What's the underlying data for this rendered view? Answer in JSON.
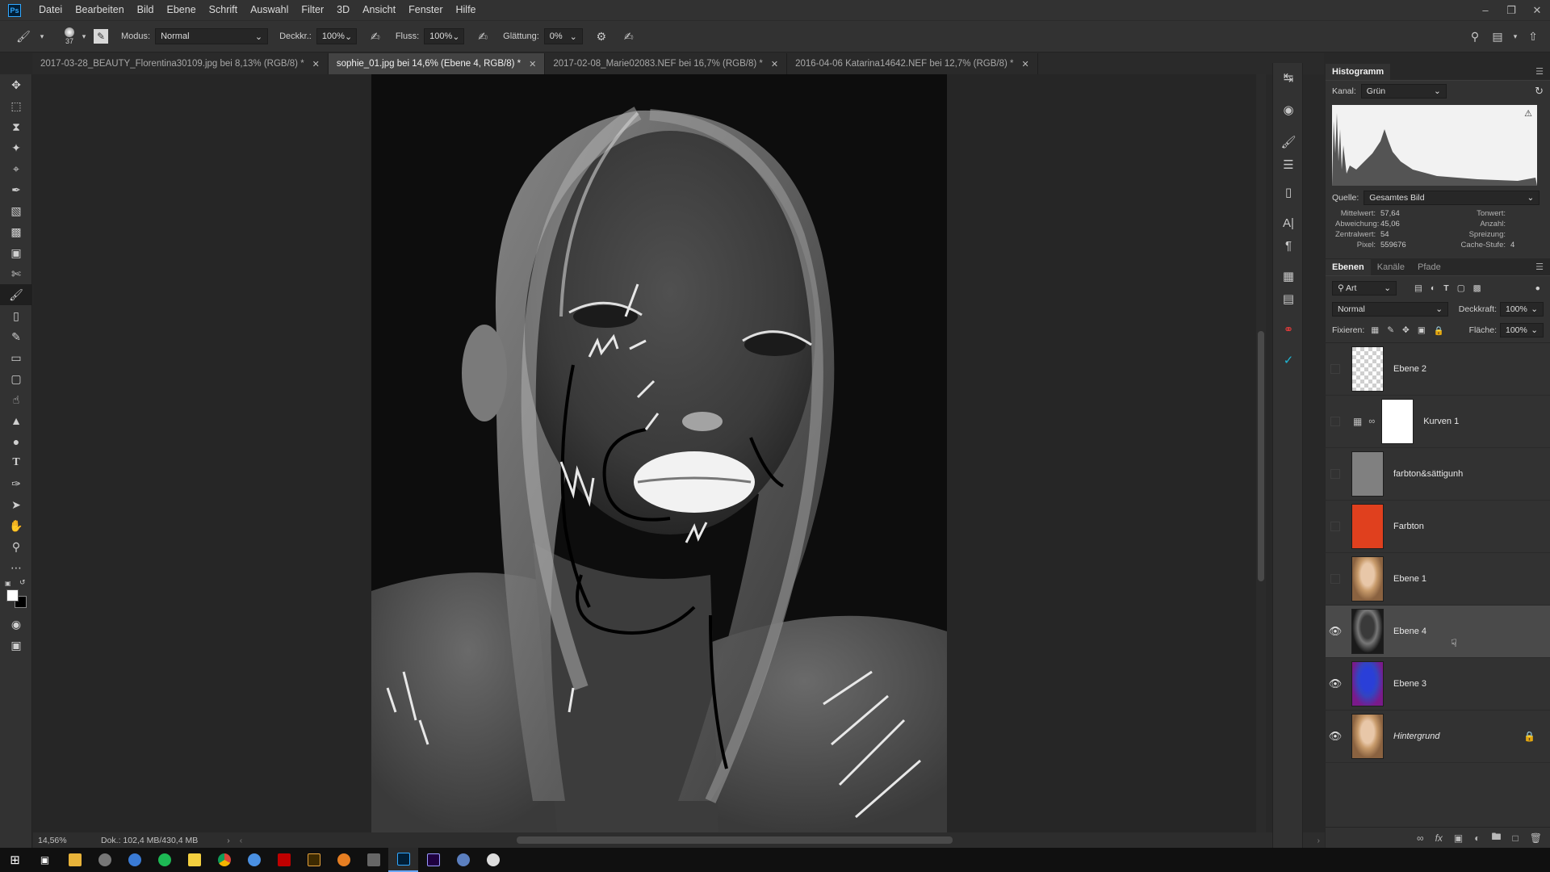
{
  "menubar": {
    "logo": "Ps",
    "items": [
      "Datei",
      "Bearbeiten",
      "Bild",
      "Ebene",
      "Schrift",
      "Auswahl",
      "Filter",
      "3D",
      "Ansicht",
      "Fenster",
      "Hilfe"
    ]
  },
  "options": {
    "brush_size": "37",
    "mode_label": "Modus:",
    "mode_value": "Normal",
    "opacity_label": "Deckkr.:",
    "opacity_value": "100%",
    "flow_label": "Fluss:",
    "flow_value": "100%",
    "smoothing_label": "Glättung:",
    "smoothing_value": "0%"
  },
  "tabs": [
    {
      "label": "2017-03-28_BEAUTY_Florentina30109.jpg bei 8,13% (RGB/8) *"
    },
    {
      "label": "sophie_01.jpg bei 14,6% (Ebene 4, RGB/8) *"
    },
    {
      "label": "2017-02-08_Marie02083.NEF bei 16,7% (RGB/8) *"
    },
    {
      "label": "2016-04-06 Katarina14642.NEF bei 12,7% (RGB/8) *"
    }
  ],
  "status": {
    "zoom": "14,56%",
    "doc": "Dok.: 102,4 MB/430,4 MB"
  },
  "histogram": {
    "title": "Histogramm",
    "channel_label": "Kanal:",
    "channel_value": "Grün",
    "source_label": "Quelle:",
    "source_value": "Gesamtes Bild",
    "stats_left": [
      {
        "k": "Mittelwert:",
        "v": "57,64"
      },
      {
        "k": "Abweichung:",
        "v": "45,06"
      },
      {
        "k": "Zentralwert:",
        "v": "54"
      },
      {
        "k": "Pixel:",
        "v": "559676"
      }
    ],
    "stats_right": [
      {
        "k": "Tonwert:",
        "v": ""
      },
      {
        "k": "Anzahl:",
        "v": ""
      },
      {
        "k": "Spreizung:",
        "v": ""
      },
      {
        "k": "Cache-Stufe:",
        "v": "4"
      }
    ]
  },
  "layers_panel": {
    "tabs": [
      "Ebenen",
      "Kanäle",
      "Pfade"
    ],
    "filter_value": "Art",
    "blend_value": "Normal",
    "opacity_label": "Deckkraft:",
    "opacity_value": "100%",
    "lock_label": "Fixieren:",
    "fill_label": "Fläche:",
    "fill_value": "100%",
    "layers": [
      {
        "name": "Ebene 2",
        "visible": false
      },
      {
        "name": "Kurven 1",
        "visible": false
      },
      {
        "name": "farbton&sättigunh",
        "visible": false
      },
      {
        "name": "Farbton",
        "visible": false
      },
      {
        "name": "Ebene 1",
        "visible": false
      },
      {
        "name": "Ebene 4",
        "visible": true
      },
      {
        "name": "Ebene 3",
        "visible": true
      },
      {
        "name": "Hintergrund",
        "visible": true
      }
    ]
  },
  "colors": {
    "farbton": "#e0401e",
    "accent": "#31a8ff"
  }
}
